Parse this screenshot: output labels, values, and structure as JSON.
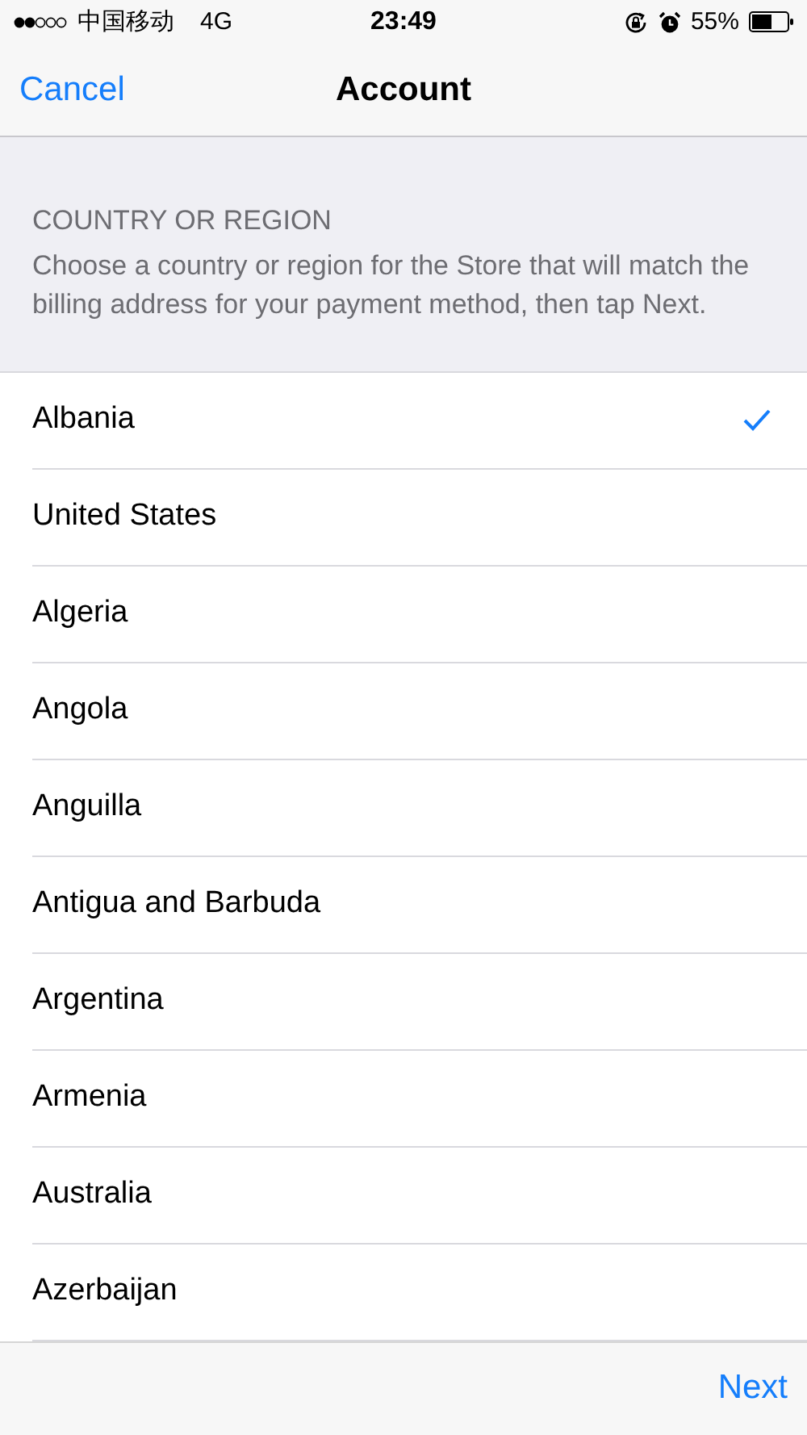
{
  "status_bar": {
    "carrier": "中国移动",
    "network": "4G",
    "time": "23:49",
    "battery": "55%"
  },
  "nav": {
    "cancel": "Cancel",
    "title": "Account"
  },
  "section": {
    "header": "COUNTRY OR REGION",
    "description": "Choose a country or region for the Store that will match the billing address for your payment method, then tap Next."
  },
  "countries": [
    {
      "name": "Albania",
      "selected": true
    },
    {
      "name": "United States",
      "selected": false
    },
    {
      "name": "Algeria",
      "selected": false
    },
    {
      "name": "Angola",
      "selected": false
    },
    {
      "name": "Anguilla",
      "selected": false
    },
    {
      "name": "Antigua and Barbuda",
      "selected": false
    },
    {
      "name": "Argentina",
      "selected": false
    },
    {
      "name": "Armenia",
      "selected": false
    },
    {
      "name": "Australia",
      "selected": false
    },
    {
      "name": "Azerbaijan",
      "selected": false
    }
  ],
  "toolbar": {
    "next": "Next"
  }
}
